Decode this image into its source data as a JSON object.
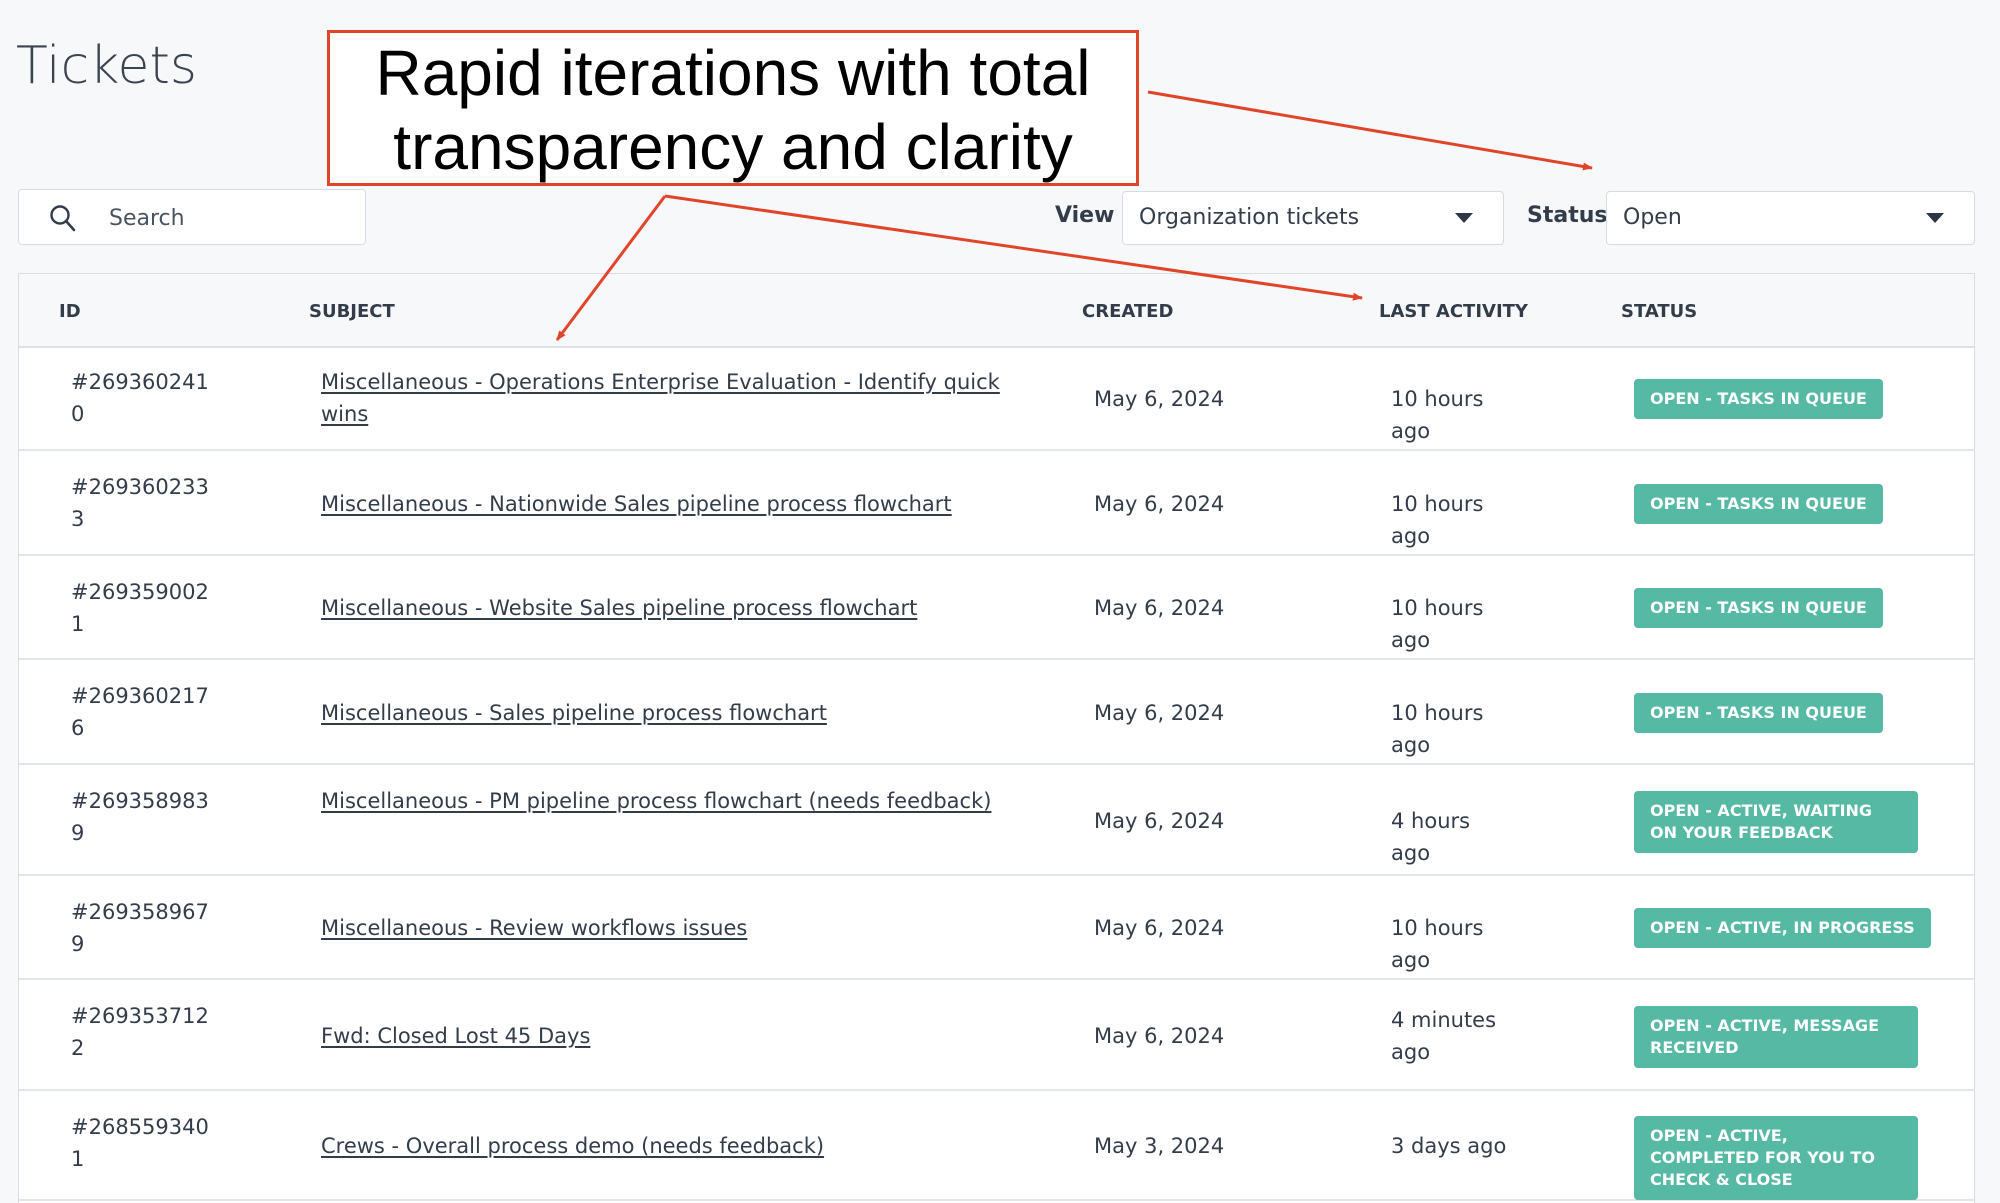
{
  "page": {
    "title": "Tickets"
  },
  "search": {
    "placeholder": "Search",
    "value": "",
    "icon": "search-icon"
  },
  "filters": {
    "view": {
      "label": "View",
      "selected": "Organization tickets"
    },
    "status": {
      "label": "Status",
      "selected": "Open"
    }
  },
  "annotation": {
    "text_line1": "Rapid iterations with total",
    "text_line2": "transparency and clarity",
    "color": "#e0452a"
  },
  "table": {
    "columns": [
      "ID",
      "SUBJECT",
      "CREATED",
      "LAST ACTIVITY",
      "STATUS"
    ],
    "rows": [
      {
        "id": "#2693602410",
        "subject": "Miscellaneous - Operations Enterprise Evaluation - Identify quick wins",
        "created": "May 6, 2024",
        "last_activity": "10 hours ago",
        "status": "OPEN - TASKS IN QUEUE"
      },
      {
        "id": "#2693602333",
        "subject": "Miscellaneous - Nationwide Sales pipeline process flowchart",
        "created": "May 6, 2024",
        "last_activity": "10 hours ago",
        "status": "OPEN - TASKS IN QUEUE"
      },
      {
        "id": "#2693590021",
        "subject": "Miscellaneous - Website Sales pipeline process flowchart",
        "created": "May 6, 2024",
        "last_activity": "10 hours ago",
        "status": "OPEN - TASKS IN QUEUE"
      },
      {
        "id": "#2693602176",
        "subject": "Miscellaneous - Sales pipeline process flowchart",
        "created": "May 6, 2024",
        "last_activity": "10 hours ago",
        "status": "OPEN - TASKS IN QUEUE"
      },
      {
        "id": "#2693589839",
        "subject": "Miscellaneous - PM pipeline process flowchart (needs feedback)",
        "created": "May 6, 2024",
        "last_activity": "4 hours ago",
        "status": "OPEN - ACTIVE, WAITING ON YOUR FEEDBACK"
      },
      {
        "id": "#2693589679",
        "subject": "Miscellaneous - Review workflows issues",
        "created": "May 6, 2024",
        "last_activity": "10 hours ago",
        "status": "OPEN - ACTIVE, IN PROGRESS"
      },
      {
        "id": "#2693537122",
        "subject": "Fwd: Closed Lost 45 Days",
        "created": "May 6, 2024",
        "last_activity": "4 minutes ago",
        "status": "OPEN - ACTIVE, MESSAGE RECEIVED"
      },
      {
        "id": "#2685593401",
        "subject": "Crews - Overall process demo (needs feedback)",
        "created": "May 3, 2024",
        "last_activity": "3 days ago",
        "status": "OPEN - ACTIVE, COMPLETED FOR YOU TO CHECK & CLOSE"
      }
    ]
  },
  "colors": {
    "badge": "#55b9a4",
    "annotation": "#e0452a",
    "text": "#333d4a"
  }
}
